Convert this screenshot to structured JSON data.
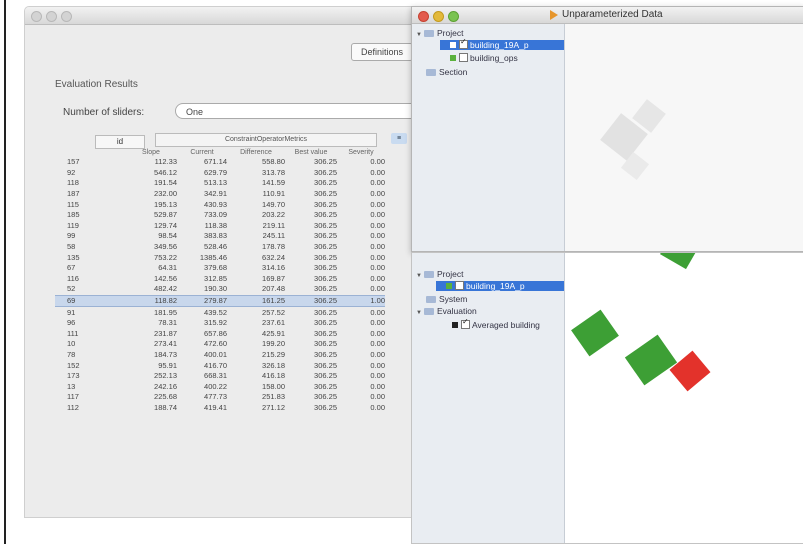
{
  "main_window": {
    "definitions_label": "Definitions",
    "evaluation_title": "Evaluation Results",
    "number_of_sliders_label": "Number of sliders:",
    "sliders_selected": "One",
    "table": {
      "id_header": "id",
      "group_header": "ConstraintOperatorMetrics",
      "icon_label": "≡",
      "columns": [
        "Slope",
        "Current",
        "Difference",
        "Best value",
        "Severity"
      ],
      "rows": [
        [
          "157",
          "112.33",
          "671.14",
          "558.80",
          "306.25",
          "0.00"
        ],
        [
          "92",
          "546.12",
          "629.79",
          "313.78",
          "306.25",
          "0.00"
        ],
        [
          "118",
          "191.54",
          "513.13",
          "141.59",
          "306.25",
          "0.00"
        ],
        [
          "187",
          "232.00",
          "342.91",
          "110.91",
          "306.25",
          "0.00"
        ],
        [
          "115",
          "195.13",
          "430.93",
          "149.70",
          "306.25",
          "0.00"
        ],
        [
          "185",
          "529.87",
          "733.09",
          "203.22",
          "306.25",
          "0.00"
        ],
        [
          "119",
          "129.74",
          "118.38",
          "219.11",
          "306.25",
          "0.00"
        ],
        [
          "99",
          "98.54",
          "383.83",
          "245.11",
          "306.25",
          "0.00"
        ],
        [
          "58",
          "349.56",
          "528.46",
          "178.78",
          "306.25",
          "0.00"
        ],
        [
          "135",
          "753.22",
          "1385.46",
          "632.24",
          "306.25",
          "0.00"
        ],
        [
          "67",
          "64.31",
          "379.68",
          "314.16",
          "306.25",
          "0.00"
        ],
        [
          "116",
          "142.56",
          "312.85",
          "169.87",
          "306.25",
          "0.00"
        ],
        [
          "52",
          "482.42",
          "190.30",
          "207.48",
          "306.25",
          "0.00"
        ],
        [
          "69",
          "118.82",
          "279.87",
          "161.25",
          "306.25",
          "1.00"
        ],
        [
          "91",
          "181.95",
          "439.52",
          "257.52",
          "306.25",
          "0.00"
        ],
        [
          "96",
          "78.31",
          "315.92",
          "237.61",
          "306.25",
          "0.00"
        ],
        [
          "111",
          "231.87",
          "657.86",
          "425.91",
          "306.25",
          "0.00"
        ],
        [
          "10",
          "273.41",
          "472.60",
          "199.20",
          "306.25",
          "0.00"
        ],
        [
          "78",
          "184.73",
          "400.01",
          "215.29",
          "306.25",
          "0.00"
        ],
        [
          "152",
          "95.91",
          "416.70",
          "326.18",
          "306.25",
          "0.00"
        ],
        [
          "173",
          "252.13",
          "668.31",
          "416.18",
          "306.25",
          "0.00"
        ],
        [
          "13",
          "242.16",
          "400.22",
          "158.00",
          "306.25",
          "0.00"
        ],
        [
          "117",
          "225.68",
          "477.73",
          "251.83",
          "306.25",
          "0.00"
        ],
        [
          "112",
          "188.74",
          "419.41",
          "271.12",
          "306.25",
          "0.00"
        ]
      ],
      "selected_row": 13
    }
  },
  "top_window": {
    "title": "Unparameterized Data",
    "tree": {
      "project": "Project",
      "item_selected": "building_19A_p",
      "item_second": "building_ops",
      "section": "Section"
    }
  },
  "bottom_window": {
    "tree": {
      "project": "Project",
      "item_selected": "building_19A_p",
      "system": "System",
      "evaluation": "Evaluation",
      "averaged": "Averaged building"
    }
  },
  "colors": {
    "green": "#3d9f35",
    "red": "#e3322b",
    "selection": "#3875d7"
  }
}
